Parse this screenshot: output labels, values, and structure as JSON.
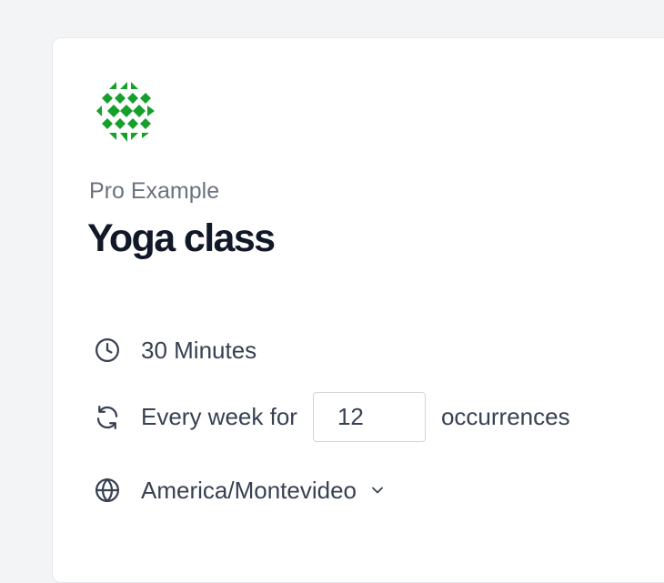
{
  "event": {
    "subtitle": "Pro Example",
    "title": "Yoga class"
  },
  "details": {
    "duration": "30 Minutes",
    "recurrence_prefix": "Every week for",
    "occurrences_value": "12",
    "recurrence_suffix": "occurrences",
    "timezone": "America/Montevideo"
  },
  "icons": {
    "logo": "green-diamond-pattern-logo",
    "duration": "clock-icon",
    "recurrence": "refresh-icon",
    "timezone": "globe-icon",
    "dropdown": "chevron-down-icon"
  },
  "colors": {
    "logo_green": "#15a02b",
    "text_dark": "#111827",
    "text_muted": "#6b7280",
    "text_body": "#374151"
  }
}
